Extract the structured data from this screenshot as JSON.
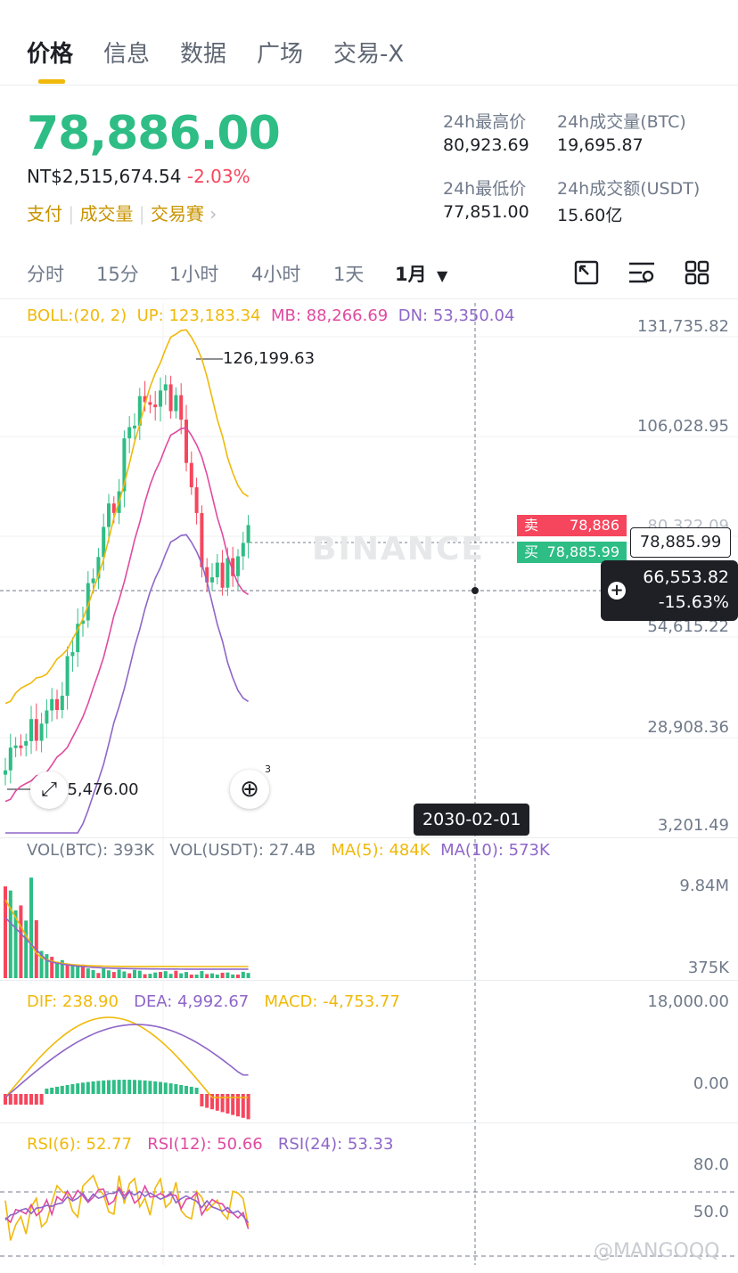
{
  "tabs": [
    "价格",
    "信息",
    "数据",
    "广场",
    "交易-X"
  ],
  "price": {
    "last": "78,886.00",
    "fiat": "NT$2,515,674.54",
    "change": "-2.03%"
  },
  "tags": [
    "支付",
    "成交量",
    "交易賽"
  ],
  "stats": {
    "high_label": "24h最高价",
    "high": "80,923.69",
    "vol_btc_label": "24h成交量(BTC)",
    "vol_btc": "19,695.87",
    "low_label": "24h最低价",
    "low": "77,851.00",
    "vol_usdt_label": "24h成交额(USDT)",
    "vol_usdt": "15.60亿"
  },
  "timeframes": [
    "分时",
    "15分",
    "1小时",
    "4小时",
    "1天",
    "1月"
  ],
  "boll": {
    "label": "BOLL:(20, 2)",
    "up": "UP: 123,183.34",
    "mb": "MB: 88,266.69",
    "dn": "DN: 53,350.04"
  },
  "price_axis": [
    "131,735.82",
    "106,028.95",
    "80,322.09",
    "54,615.22",
    "28,908.36",
    "3,201.49"
  ],
  "annotations": {
    "high_mark": "126,199.63",
    "low_mark": "15,476.00"
  },
  "orderbook": {
    "sell_label": "卖",
    "sell_price": "78,886",
    "buy_label": "买",
    "buy_price": "78,885.99",
    "last_price": "78,885.99"
  },
  "crosshair": {
    "price": "66,553.82",
    "pct": "-15.63%",
    "date": "2030-02-01"
  },
  "watermark": "BINANCE",
  "vol": {
    "btc": "VOL(BTC): 393K",
    "usdt": "VOL(USDT): 27.4B",
    "ma5": "MA(5): 484K",
    "ma10": "MA(10): 573K",
    "axis_top": "9.84M",
    "axis_bottom": "375K"
  },
  "macd": {
    "dif": "DIF: 238.90",
    "dea": "DEA: 4,992.67",
    "macd": "MACD: -4,753.77",
    "axis_top": "18,000.00",
    "axis_zero": "0.00"
  },
  "rsi": {
    "rsi6": "RSI(6): 52.77",
    "rsi12": "RSI(12): 50.66",
    "rsi24": "RSI(24): 53.33",
    "axis_80": "80.0",
    "axis_50": "50.0"
  },
  "footer_watermark": "@MANGOQQ",
  "bubble_count": "3",
  "colors": {
    "up": "#2ebd85",
    "down": "#f6465d",
    "gold": "#f0b90b",
    "pink": "#e04aa0",
    "purple": "#8e66c8"
  }
}
